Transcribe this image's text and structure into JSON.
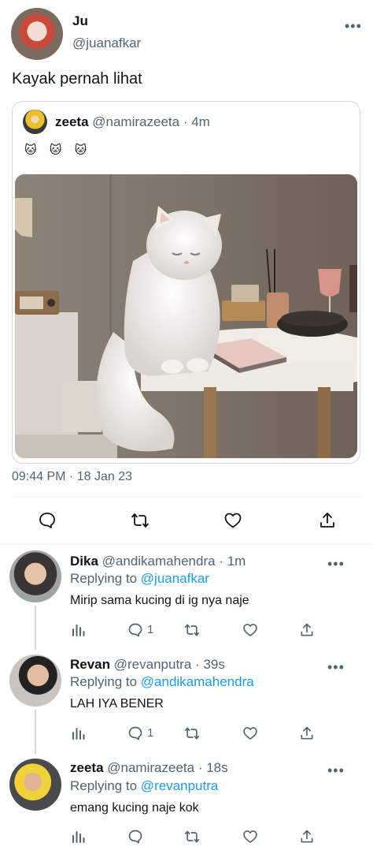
{
  "tweet": {
    "name": "Ju",
    "handle": "@juanafkar",
    "text": "Kayak pernah lihat",
    "timestamp": "09:44 PM · 18 Jan 23",
    "more": "•••"
  },
  "quote": {
    "name": "zeeta",
    "handle": "@namirazeeta",
    "time": "4m",
    "text": "🐱 🐱 🐱"
  },
  "actions": [
    "reply-icon",
    "retweet-icon",
    "like-icon",
    "share-icon"
  ],
  "replies": [
    {
      "name": "Dika",
      "handle": "@andikamahendra",
      "time": "1m",
      "replying_prefix": "Replying to ",
      "replying_to": "@juanafkar",
      "text": "Mirip sama kucing di ig nya naje",
      "reply_count": "1"
    },
    {
      "name": "Revan",
      "handle": "@revanputra",
      "time": "39s",
      "replying_prefix": "Replying to ",
      "replying_to": "@andikamahendra",
      "text": "LAH IYA BENER",
      "reply_count": "1"
    },
    {
      "name": "zeeta",
      "handle": "@namirazeeta",
      "time": "18s",
      "replying_prefix": "Replying to ",
      "replying_to": "@revanputra",
      "text": "emang kucing naje kok",
      "reply_count": ""
    }
  ],
  "colors": {
    "link": "#1d9bf0",
    "muted": "#536471",
    "border": "#cfd9de"
  }
}
